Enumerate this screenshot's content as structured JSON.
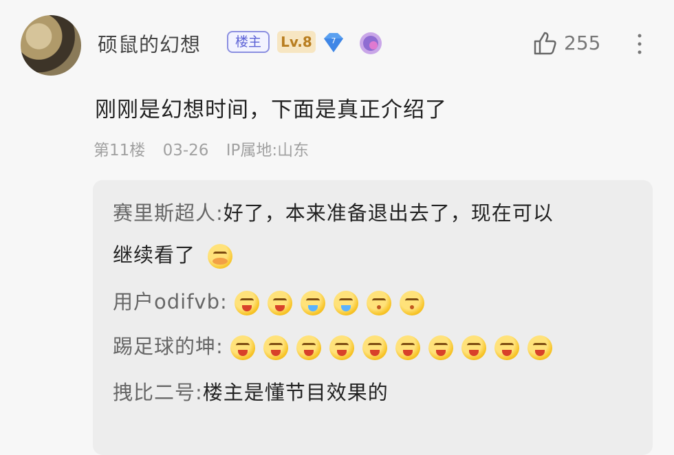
{
  "comment": {
    "username": "硕鼠的幻想",
    "badge_louzhu": "楼主",
    "badge_level": "Lv.8",
    "badge_diamond": "7",
    "like_count": "255",
    "text": "刚刚是幻想时间，下面是真正介绍了",
    "floor": "第11楼",
    "date": "03-26",
    "ip": "IP属地:山东"
  },
  "replies": [
    {
      "name": "赛里斯超人:",
      "text_line1": "好了，本来准备退出去了，现在可以",
      "text_line2": "继续看了"
    },
    {
      "name": "用户odifvb:",
      "emojis": [
        "grin",
        "grin",
        "cry",
        "cry",
        "shy",
        "shy"
      ]
    },
    {
      "name": "踢足球的坤:",
      "emojis": [
        "grin",
        "grin",
        "grin",
        "grin",
        "grin",
        "grin",
        "grin",
        "grin",
        "grin",
        "grin"
      ]
    },
    {
      "name": "拽比二号:",
      "text_line1": "楼主是懂节目效果的"
    }
  ],
  "colors": {
    "accent_louzhu": "#5d63d6",
    "level": "#b87d1f",
    "meta": "#a0a0a0"
  }
}
